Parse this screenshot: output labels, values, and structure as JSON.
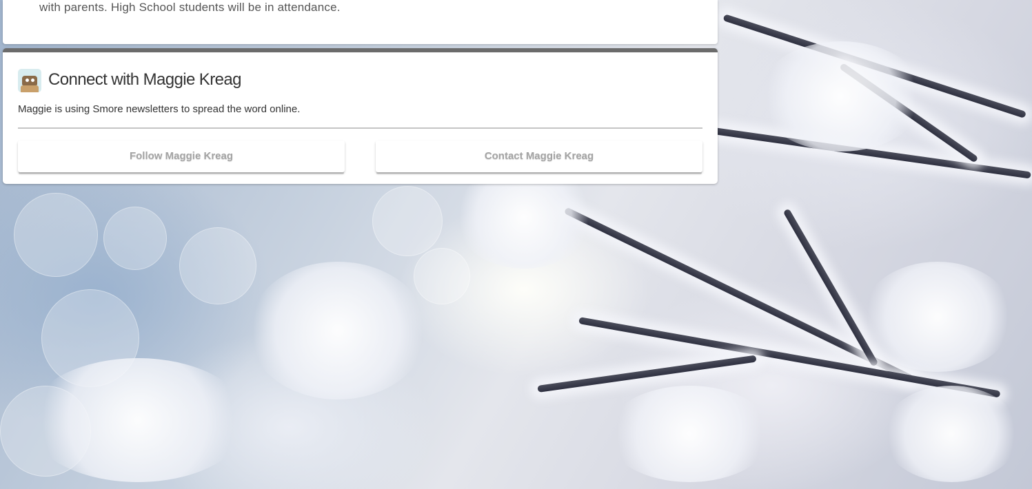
{
  "event_card": {
    "text_line": "with parents. High School students will be in attendance."
  },
  "connect": {
    "avatar_icon": "smore-avatar-icon",
    "title": "Connect with Maggie Kreag",
    "subtitle": "Maggie is using Smore newsletters to spread the word online.",
    "follow_label": "Follow Maggie Kreag",
    "contact_label": "Contact Maggie Kreag"
  },
  "background": {
    "description_icon": "frosted-branches-image"
  },
  "colors": {
    "card_accent": "#6b6b6b",
    "button_text": "#a4a4a4",
    "body_text": "#333333"
  }
}
